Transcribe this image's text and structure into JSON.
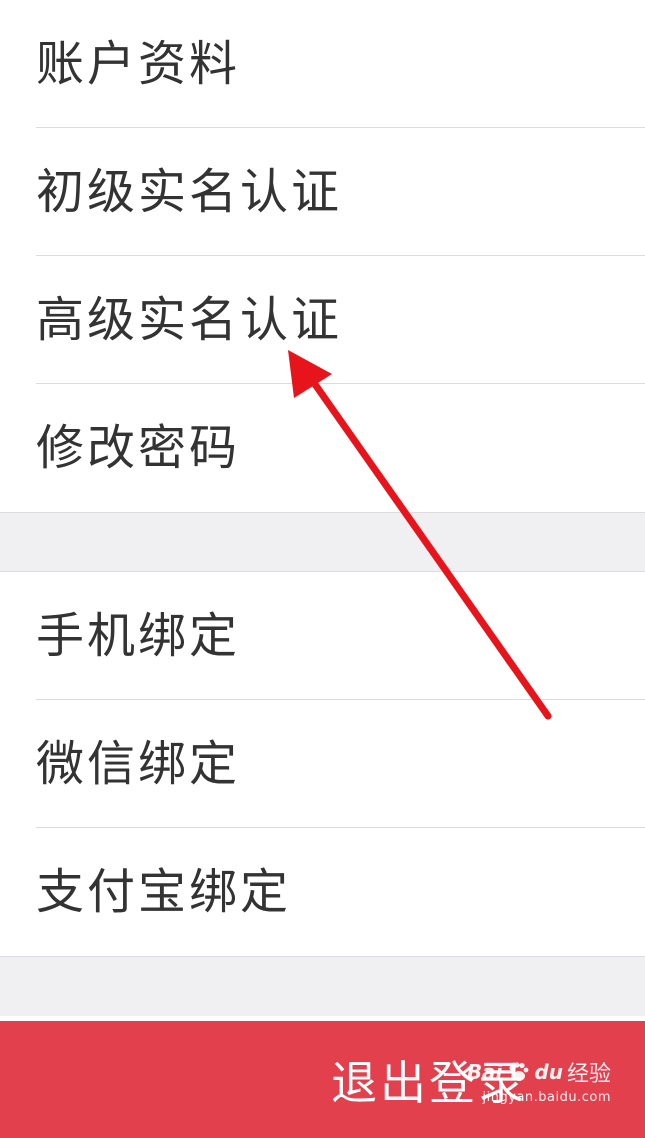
{
  "menu_group_1": [
    {
      "label": "账户资料"
    },
    {
      "label": "初级实名认证"
    },
    {
      "label": "高级实名认证"
    },
    {
      "label": "修改密码"
    }
  ],
  "menu_group_2": [
    {
      "label": "手机绑定"
    },
    {
      "label": "微信绑定"
    },
    {
      "label": "支付宝绑定"
    }
  ],
  "logout": {
    "label": "退出登录"
  },
  "watermark": {
    "brand": "Bai",
    "brand_suffix": "du",
    "text": "经验",
    "url": "jingyan.baidu.com"
  },
  "colors": {
    "accent": "#e3404e",
    "annotation_arrow": "#e8141c",
    "text": "#333333",
    "separator": "#dcdcdc",
    "background_gray": "#f0f0f2"
  }
}
